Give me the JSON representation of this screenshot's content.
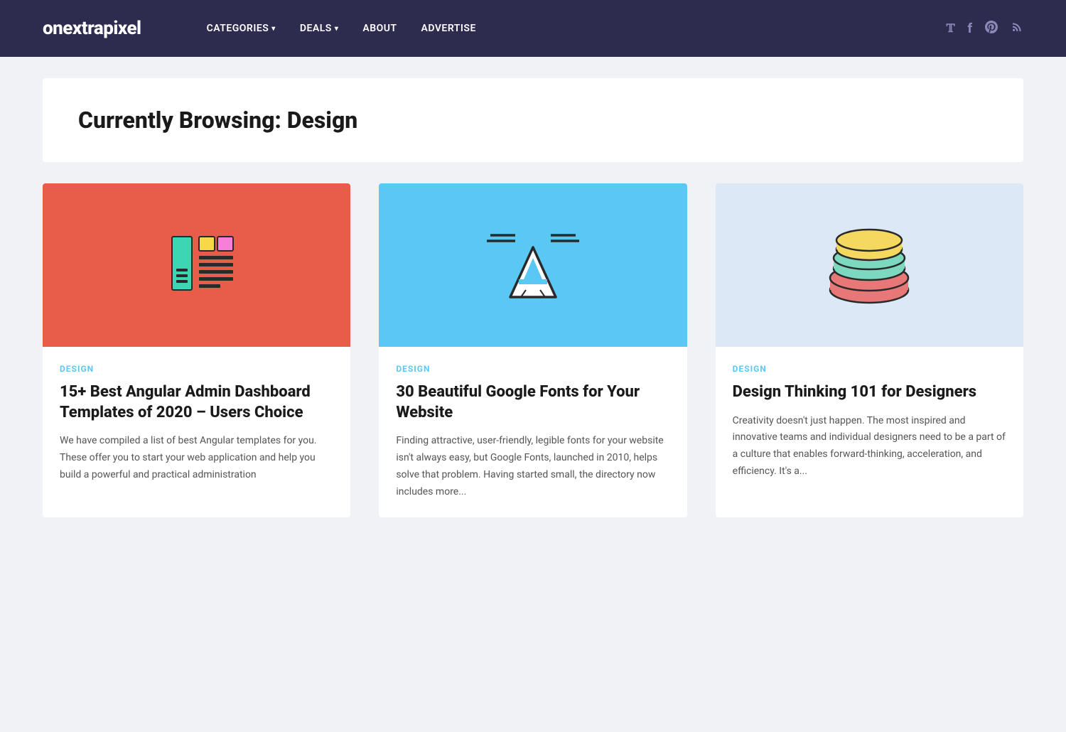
{
  "header": {
    "logo": "onextrapixel",
    "nav": [
      {
        "label": "CATEGORIES",
        "hasDropdown": true,
        "name": "nav-categories"
      },
      {
        "label": "DEALS",
        "hasDropdown": true,
        "name": "nav-deals"
      },
      {
        "label": "ABOUT",
        "hasDropdown": false,
        "name": "nav-about"
      },
      {
        "label": "ADVERTISE",
        "hasDropdown": false,
        "name": "nav-advertise"
      }
    ],
    "social": [
      {
        "icon": "twitter",
        "symbol": "𝕏"
      },
      {
        "icon": "facebook",
        "symbol": "f"
      },
      {
        "icon": "pinterest",
        "symbol": "𝗣"
      },
      {
        "icon": "rss",
        "symbol": "◉"
      }
    ]
  },
  "hero": {
    "title": "Currently Browsing: Design"
  },
  "cards": [
    {
      "category": "DESIGN",
      "title": "15+ Best Angular Admin Dashboard Templates of 2020 – Users Choice",
      "excerpt": "We have compiled a list of best Angular templates for you. These offer you to start your web application and help you build a powerful and practical administration",
      "imageTheme": "red",
      "iconType": "dashboard"
    },
    {
      "category": "DESIGN",
      "title": "30 Beautiful Google Fonts for Your Website",
      "excerpt": "Finding attractive, user-friendly, legible fonts for your website isn't always easy, but Google Fonts, launched in 2010, helps solve that problem. Having started small, the directory now includes more...",
      "imageTheme": "blue",
      "iconType": "typography"
    },
    {
      "category": "DESIGN",
      "title": "Design Thinking 101 for Designers",
      "excerpt": "Creativity doesn't just happen. The most inspired and innovative teams and individual designers need to be a part of a culture that enables forward-thinking, acceleration, and efficiency. It's a...",
      "imageTheme": "light-blue",
      "iconType": "layers"
    }
  ]
}
